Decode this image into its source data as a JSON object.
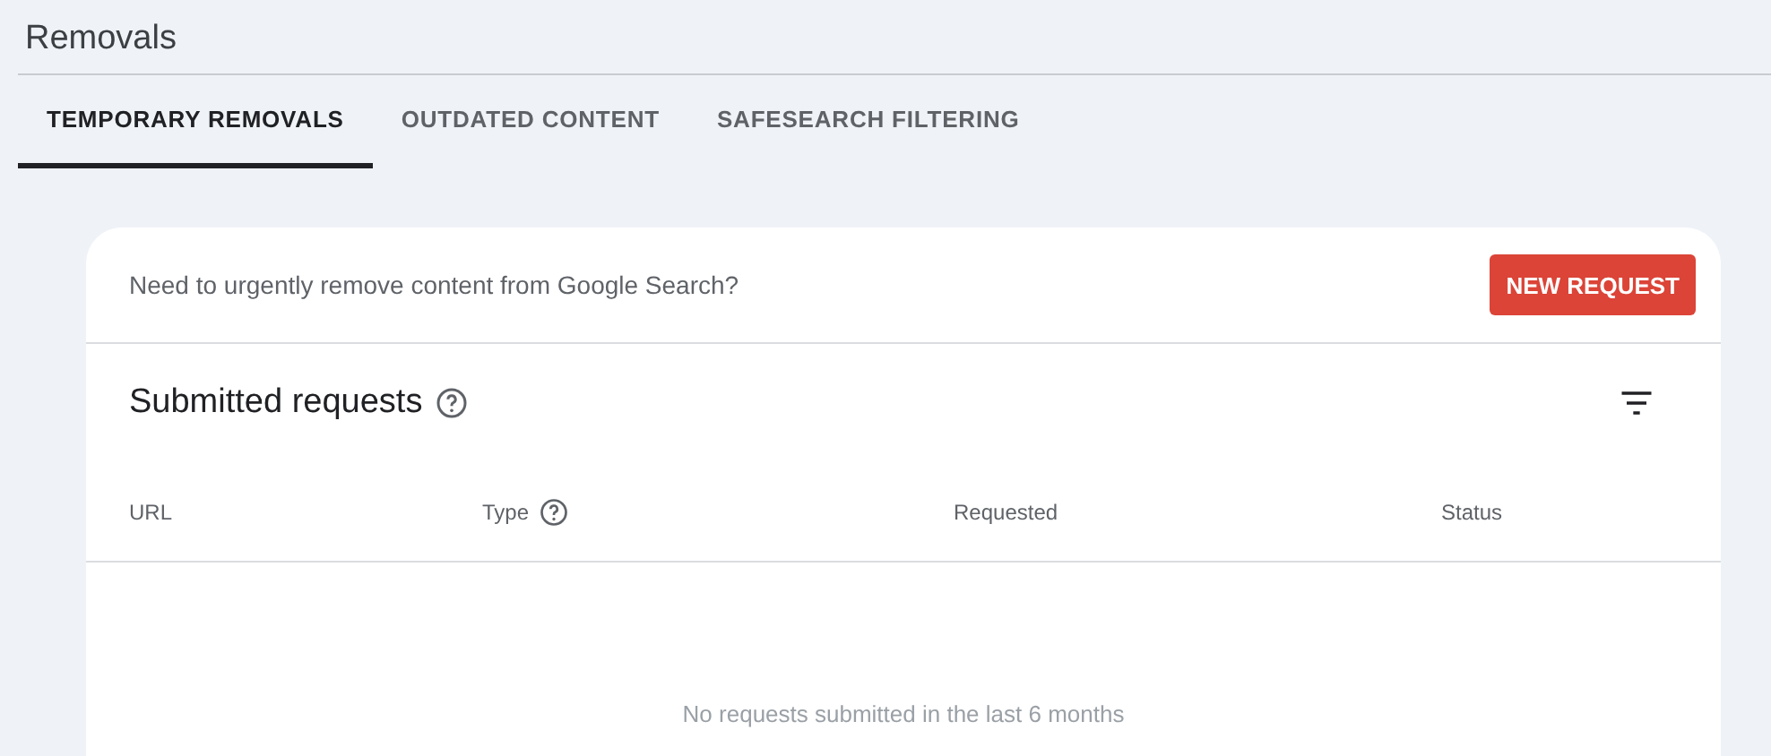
{
  "page": {
    "title": "Removals"
  },
  "tabs": [
    {
      "label": "TEMPORARY REMOVALS",
      "selected": true
    },
    {
      "label": "OUTDATED CONTENT",
      "selected": false
    },
    {
      "label": "SAFESEARCH FILTERING",
      "selected": false
    }
  ],
  "banner": {
    "text": "Need to urgently remove content from Google Search?",
    "button": "NEW REQUEST"
  },
  "table": {
    "title": "Submitted requests",
    "columns": [
      {
        "label": "URL",
        "help": false
      },
      {
        "label": "Type",
        "help": true
      },
      {
        "label": "Requested",
        "help": false
      },
      {
        "label": "Status",
        "help": false
      }
    ],
    "empty_message": "No requests submitted in the last 6 months"
  }
}
